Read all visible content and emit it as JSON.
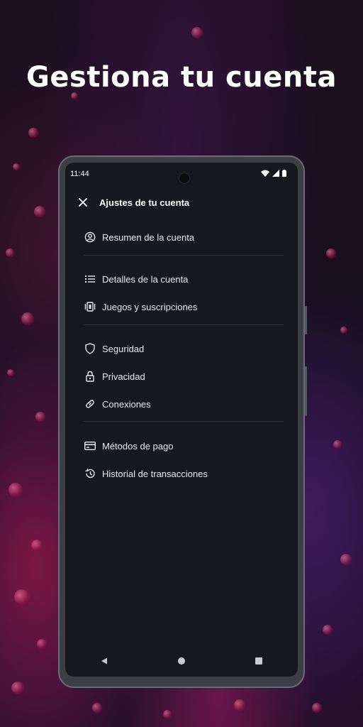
{
  "headline": "Gestiona tu cuenta",
  "status_bar": {
    "time": "11:44",
    "icons": [
      "wifi-icon",
      "signal-icon",
      "battery-icon"
    ]
  },
  "appbar": {
    "close_icon": "close-icon",
    "title": "Ajustes de tu cuenta"
  },
  "menu": {
    "groups": [
      [
        {
          "label": "Resumen de la cuenta",
          "icon": "account-circle-icon"
        }
      ],
      [
        {
          "label": "Detalles de la cuenta",
          "icon": "list-icon"
        },
        {
          "label": "Juegos y suscripciones",
          "icon": "games-icon"
        }
      ],
      [
        {
          "label": "Seguridad",
          "icon": "shield-icon"
        },
        {
          "label": "Privacidad",
          "icon": "lock-icon"
        },
        {
          "label": "Conexiones",
          "icon": "link-icon"
        }
      ],
      [
        {
          "label": "Métodos de pago",
          "icon": "credit-card-icon"
        },
        {
          "label": "Historial de transacciones",
          "icon": "history-icon"
        }
      ]
    ]
  },
  "navbar": {
    "icons": [
      "back-icon",
      "home-icon",
      "recents-icon"
    ]
  },
  "colors": {
    "screen_bg": "#17181d",
    "text": "#e9e9ec",
    "divider": "#2f3138"
  }
}
